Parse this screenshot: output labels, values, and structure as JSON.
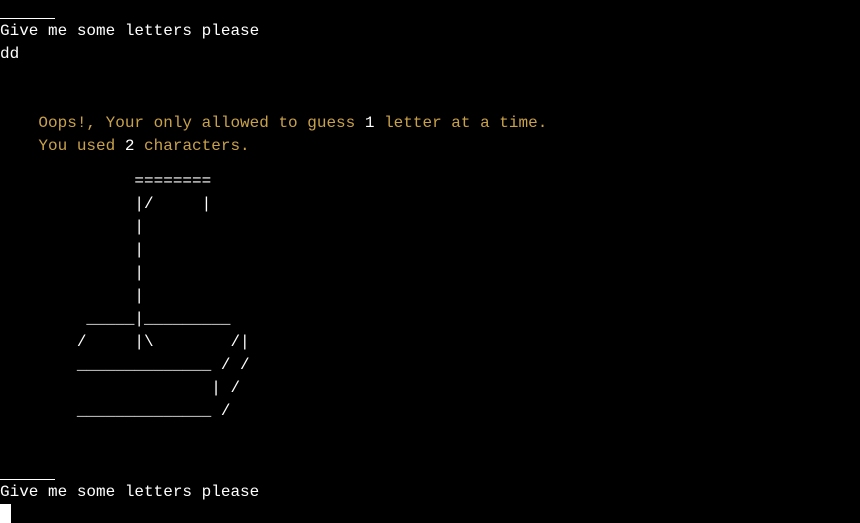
{
  "colors": {
    "background": "#000000",
    "text": "#ffffff",
    "warning": "#c9a14a"
  },
  "prompt_1": {
    "text": "Give me some letters please"
  },
  "user_input_1": {
    "text": "dd"
  },
  "error": {
    "line1_part1": "Oops!, Your only allowed to guess ",
    "line1_number": "1",
    "line1_part2": " letter at a time.",
    "line2_part1": "You used ",
    "line2_number": "2",
    "line2_part2": " characters."
  },
  "hangman_art": "              ========\n              |/     |\n              |\n              |\n              |\n              |\n         _____|_________\n        /     |\\        /|\n        ______________ / /\n                      | /\n        ______________ /",
  "prompt_2": {
    "text": "Give me some letters please"
  }
}
